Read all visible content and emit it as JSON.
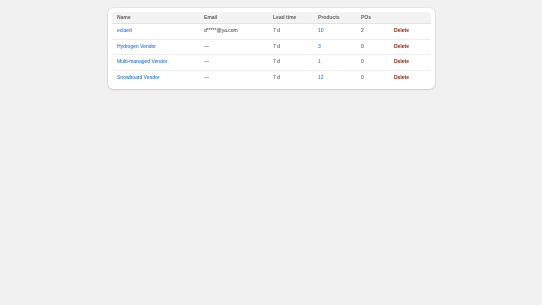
{
  "table": {
    "headers": {
      "name": "Name",
      "email": "Email",
      "lead_time": "Lead time",
      "products": "Products",
      "pos": "POs",
      "actions": ""
    },
    "rows": [
      {
        "name": "eclaed",
        "email": "d*****@ya.com",
        "lead_time": "7 d",
        "products": "10",
        "pos": "2",
        "action": "Delete"
      },
      {
        "name": "Hydrogen Vendor",
        "email": "—",
        "lead_time": "7 d",
        "products": "3",
        "pos": "0",
        "action": "Delete"
      },
      {
        "name": "Multi-managed Vendor",
        "email": "—",
        "lead_time": "7 d",
        "products": "1",
        "pos": "0",
        "action": "Delete"
      },
      {
        "name": "Snowboard Vendor",
        "email": "—",
        "lead_time": "7 d",
        "products": "12",
        "pos": "0",
        "action": "Delete"
      }
    ]
  },
  "colors": {
    "link": "#005bd3",
    "delete": "#8e1f0b",
    "background": "#f1f1f1"
  }
}
